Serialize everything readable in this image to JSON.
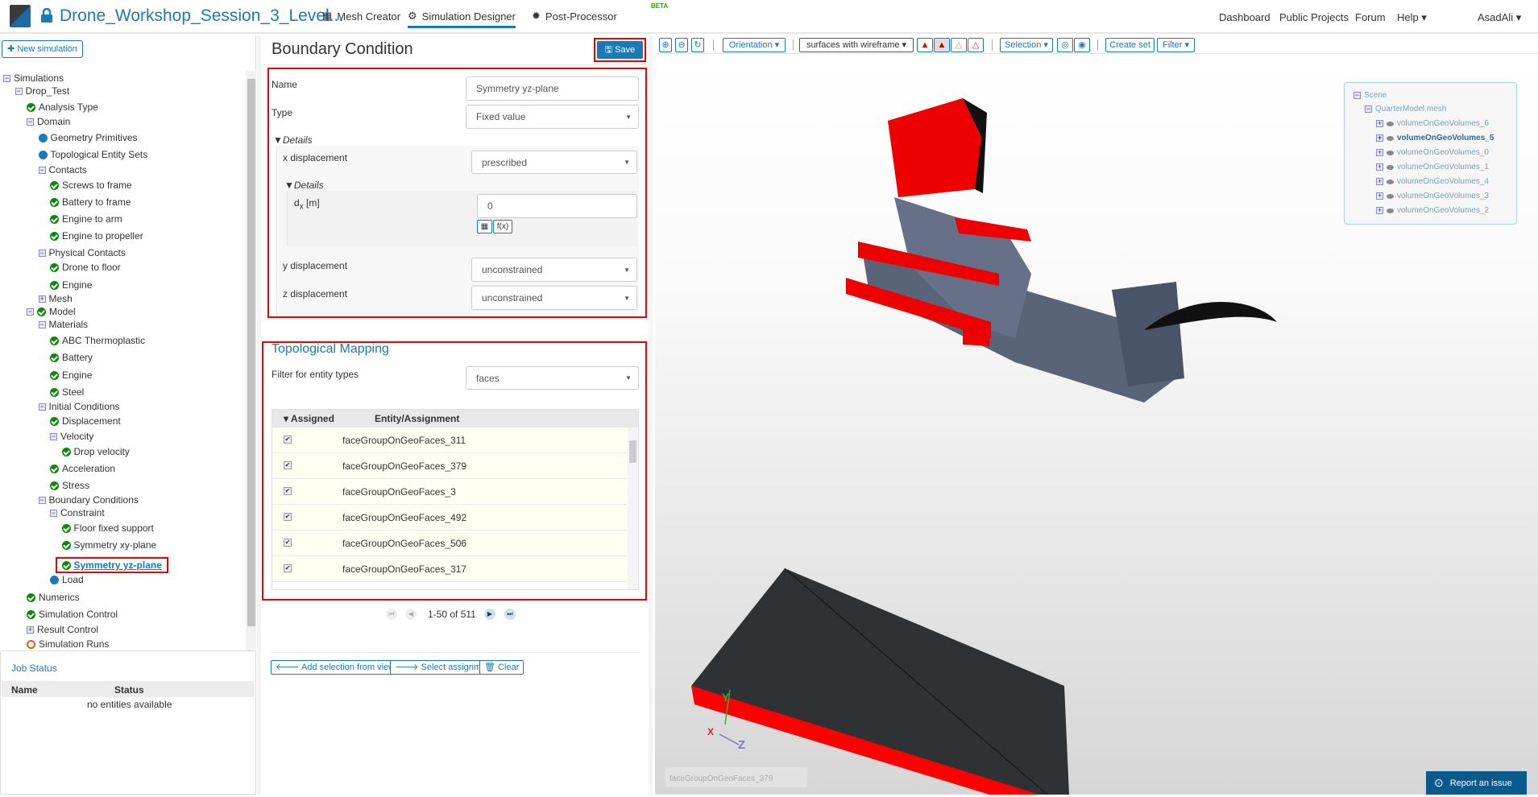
{
  "header": {
    "project_title": "Drone_Workshop_Session_3_Level...",
    "tabs": [
      {
        "label": "Mesh Creator"
      },
      {
        "label": "Simulation Designer"
      },
      {
        "label": "Post-Processor"
      }
    ],
    "beta_badge": "BETA",
    "nav": [
      "Dashboard",
      "Public Projects",
      "Forum",
      "Help"
    ],
    "user": "AsadAli"
  },
  "sidebar": {
    "new_simulation": "New simulation",
    "tree": [
      {
        "label": "Simulations",
        "icon": "collapse"
      },
      {
        "label": "Drop_Test",
        "icon": "collapse"
      },
      {
        "label": "Analysis Type",
        "icon": "ok"
      },
      {
        "label": "Domain",
        "icon": "collapse"
      },
      {
        "label": "Geometry Primitives",
        "icon": "dot"
      },
      {
        "label": "Topological Entity Sets",
        "icon": "dot"
      },
      {
        "label": "Contacts",
        "icon": "collapse"
      },
      {
        "label": "Screws to frame",
        "icon": "ok"
      },
      {
        "label": "Battery to frame",
        "icon": "ok"
      },
      {
        "label": "Engine to arm",
        "icon": "ok"
      },
      {
        "label": "Engine to propeller",
        "icon": "ok"
      },
      {
        "label": "Physical Contacts",
        "icon": "collapse"
      },
      {
        "label": "Drone to floor",
        "icon": "ok"
      },
      {
        "label": "Engine",
        "icon": "ok"
      },
      {
        "label": "Mesh",
        "icon": "expand"
      },
      {
        "label": "Model",
        "icon": "collapse-ok"
      },
      {
        "label": "Materials",
        "icon": "collapse"
      },
      {
        "label": "ABC Thermoplastic",
        "icon": "ok"
      },
      {
        "label": "Battery",
        "icon": "ok"
      },
      {
        "label": "Engine",
        "icon": "ok"
      },
      {
        "label": "Steel",
        "icon": "ok"
      },
      {
        "label": "Initial Conditions",
        "icon": "collapse"
      },
      {
        "label": "Displacement",
        "icon": "ok"
      },
      {
        "label": "Velocity",
        "icon": "collapse"
      },
      {
        "label": "Drop velocity",
        "icon": "ok"
      },
      {
        "label": "Acceleration",
        "icon": "ok"
      },
      {
        "label": "Stress",
        "icon": "ok"
      },
      {
        "label": "Boundary Conditions",
        "icon": "collapse"
      },
      {
        "label": "Constraint",
        "icon": "collapse"
      },
      {
        "label": "Floor fixed support",
        "icon": "ok"
      },
      {
        "label": "Symmetry xy-plane",
        "icon": "ok"
      },
      {
        "label": "Symmetry yz-plane",
        "icon": "ok",
        "selected": true
      },
      {
        "label": "Load",
        "icon": "dot"
      },
      {
        "label": "Numerics",
        "icon": "ok"
      },
      {
        "label": "Simulation Control",
        "icon": "ok"
      },
      {
        "label": "Result Control",
        "icon": "expand"
      },
      {
        "label": "Simulation Runs",
        "icon": "ring"
      }
    ],
    "job_status": {
      "title": "Job Status",
      "columns": [
        "Name",
        "Status"
      ],
      "empty": "no entities available"
    }
  },
  "bc": {
    "title": "Boundary Condition",
    "save": "Save",
    "name_label": "Name",
    "name_value": "Symmetry yz-plane",
    "type_label": "Type",
    "type_value": "Fixed value",
    "details": "Details",
    "x_label": "x displacement",
    "x_value": "prescribed",
    "inner_details": "Details",
    "dx_label": "d",
    "dx_sub": "x",
    "dx_unit": "[m]",
    "dx_value": "0",
    "fx": "f(x)",
    "y_label": "y displacement",
    "y_value": "unconstrained",
    "z_label": "z displacement",
    "z_value": "unconstrained"
  },
  "mapping": {
    "title": "Topological Mapping",
    "filter_label": "Filter for entity types",
    "filter_value": "faces",
    "columns": [
      "Assigned",
      "Entity/Assignment"
    ],
    "rows": [
      "faceGroupOnGeoFaces_311",
      "faceGroupOnGeoFaces_379",
      "faceGroupOnGeoFaces_3",
      "faceGroupOnGeoFaces_492",
      "faceGroupOnGeoFaces_506",
      "faceGroupOnGeoFaces_317"
    ],
    "pagination": "1-50 of 511",
    "add_selection": "Add selection from viewer",
    "select_assignment": "Select assignment",
    "clear": "Clear"
  },
  "viewer": {
    "orientation": "Orientation",
    "render_mode": "surfaces with wireframe",
    "selection": "Selection",
    "create_set": "Create set",
    "filter": "Filter",
    "scene": {
      "root": "Scene",
      "mesh": "QuarterModel mesh",
      "volumes": [
        "volumeOnGeoVolumes_6",
        "volumeOnGeoVolumes_5",
        "volumeOnGeoVolumes_0",
        "volumeOnGeoVolumes_1",
        "volumeOnGeoVolumes_4",
        "volumeOnGeoVolumes_3",
        "volumeOnGeoVolumes_2"
      ],
      "bold_index": 1
    },
    "axes": [
      "X",
      "Y",
      "Z"
    ],
    "selection_box": "faceGroupOnGeoFaces_379",
    "report": "Report an issue"
  },
  "colors": {
    "accent": "#1a7ab8",
    "highlight": "#ff0000",
    "ok": "#0a8a0a"
  }
}
